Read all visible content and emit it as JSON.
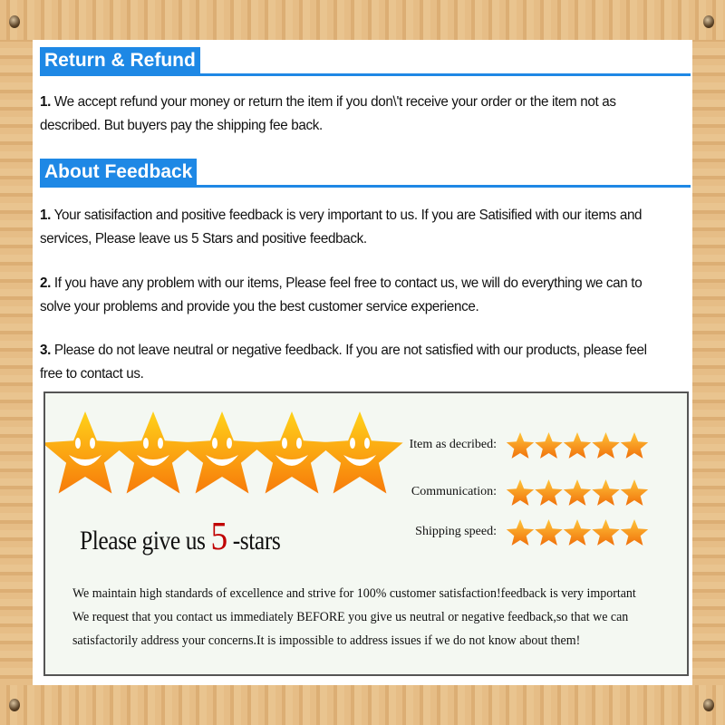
{
  "return_refund": {
    "title": "Return & Refund",
    "items": [
      {
        "num": "1.",
        "text": " We accept refund your money or return the item if you don\\'t receive your order or the item not as described. But buyers pay the shipping fee back."
      }
    ]
  },
  "about_feedback": {
    "title": "About Feedback",
    "items": [
      {
        "num": "1.",
        "text": " Your satisifaction and positive feedback is very important to us. If you are Satisified with our items and services, Please leave us 5 Stars and positive feedback."
      },
      {
        "num": "2.",
        "text": " If you have any problem with our items, Please feel free to contact us, we will do everything we can to solve your problems and provide you the best customer service experience."
      },
      {
        "num": "3.",
        "text": " Please do not leave neutral or negative feedback. If you are not satisfied with our products, please feel free to contact us."
      }
    ]
  },
  "banner": {
    "slogan_pre": "Please give us ",
    "slogan_num": "5",
    "slogan_post": " -stars",
    "ratings": [
      {
        "label": "Item as decribed:",
        "stars": 5
      },
      {
        "label": "Communication:",
        "stars": 5
      },
      {
        "label": "Shipping speed:",
        "stars": 5
      }
    ],
    "lines": [
      "We maintain high standards of excellence and strive for 100% customer satisfaction!feedback is very important",
      "We request that you contact us immediately BEFORE you give us neutral or negative feedback,so that we can",
      "satisfactorily address your concerns.It is impossible to address issues if we do not know about them!"
    ]
  },
  "colors": {
    "header_blue": "#1e88e5",
    "star_orange": "#f7931e",
    "accent_red": "#c00000"
  }
}
